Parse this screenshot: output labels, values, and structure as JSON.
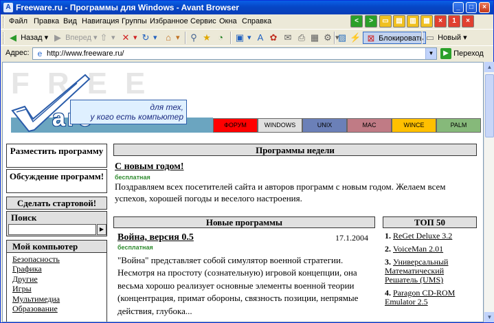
{
  "window": {
    "title": "Freeware.ru - Программы для Windows - Avant Browser"
  },
  "menu": {
    "items": [
      "Файл",
      "Правка",
      "Вид",
      "Навигация",
      "Группы",
      "Избранное",
      "Сервис",
      "Окна",
      "Справка"
    ]
  },
  "toolbar": {
    "back_label": "Назад",
    "forward_label": "Вперед",
    "block_label": "Блокировать",
    "new_label": "Новый"
  },
  "address": {
    "label": "Адрес:",
    "url": "http://www.freeware.ru/",
    "go_label": "Переход"
  },
  "site": {
    "tagline_line1": "для тех,",
    "tagline_line2": "у кого есть компьютер",
    "platforms": [
      "ФОРУМ",
      "WINDOWS",
      "UNIX",
      "MAC",
      "WINCE",
      "PALM"
    ],
    "colors": {
      "forum": "#ff0000",
      "windows": "#e0e0e0",
      "unix": "#6b80b8",
      "mac": "#c07b85",
      "wince": "#ffc000",
      "palm": "#86b97a"
    },
    "sidebar": {
      "post_program": "Разместить программу",
      "discuss_program": "Обсуждение программ!",
      "make_start": "Сделать стартовой!",
      "search_title": "Поиск",
      "my_computer_title": "Мой компьютер",
      "my_computer_items": [
        "Безопасность",
        "Графика",
        "Другие",
        "Игры",
        "Мультимедиа",
        "Образование"
      ]
    },
    "weekly": {
      "header": "Программы недели",
      "news_title": "С новым годом!",
      "news_badge": "бесплатная",
      "news_text": "Поздравляем всех посетителей сайта и авторов программ с новым годом. Желаем всем успехов, хорошей погоды и веселого настроения."
    },
    "new_programs": {
      "header": "Новые программы",
      "item_title": "Война, версия 0.5",
      "item_date": "17.1.2004",
      "item_badge": "бесплатная",
      "item_text": "\"Война\" представляет собой симулятор военной стратегии. Несмотря на простоту (сознательную) игровой концепции, она весьма хорошо реализует основные элементы военной теории (концентрация, примат обороны, связность позиции, непрямые действия, глубока..."
    },
    "top50": {
      "header": "ТОП 50",
      "items": [
        {
          "rank": "1.",
          "name": "ReGet Deluxe 3.2"
        },
        {
          "rank": "2.",
          "name": "VoiceMan 2.01"
        },
        {
          "rank": "3.",
          "name": "Универсальный Математический Решатель (UMS)"
        },
        {
          "rank": "4.",
          "name": "Paragon CD-ROM Emulator 2.5"
        }
      ]
    }
  }
}
